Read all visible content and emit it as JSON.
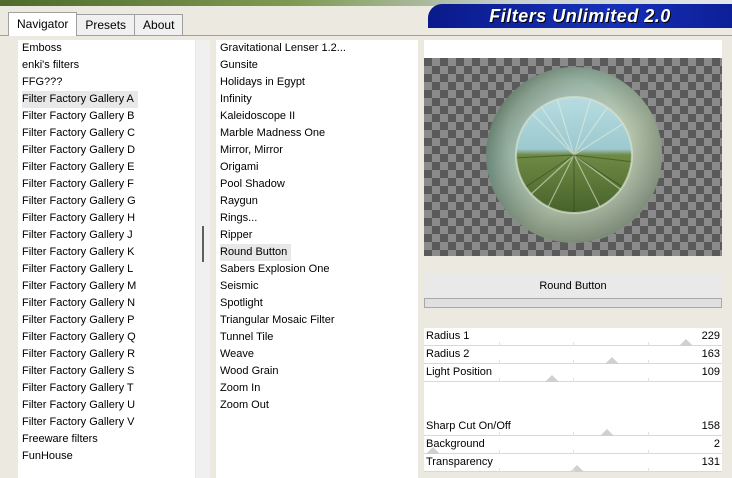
{
  "tabs": [
    "Navigator",
    "Presets",
    "About"
  ],
  "app_title": "Filters Unlimited 2.0",
  "categories": [
    "Emboss",
    "enki's filters",
    "FFG???",
    "Filter Factory Gallery A",
    "Filter Factory Gallery B",
    "Filter Factory Gallery C",
    "Filter Factory Gallery D",
    "Filter Factory Gallery E",
    "Filter Factory Gallery F",
    "Filter Factory Gallery G",
    "Filter Factory Gallery H",
    "Filter Factory Gallery J",
    "Filter Factory Gallery K",
    "Filter Factory Gallery L",
    "Filter Factory Gallery M",
    "Filter Factory Gallery N",
    "Filter Factory Gallery P",
    "Filter Factory Gallery Q",
    "Filter Factory Gallery R",
    "Filter Factory Gallery S",
    "Filter Factory Gallery T",
    "Filter Factory Gallery U",
    "Filter Factory Gallery V",
    "Freeware filters",
    "FunHouse"
  ],
  "selected_category": "Filter Factory Gallery A",
  "filters": [
    "Gravitational Lenser 1.2...",
    "Gunsite",
    "Holidays in Egypt",
    "Infinity",
    "Kaleidoscope II",
    "Marble Madness One",
    "Mirror, Mirror",
    "Origami",
    "Pool Shadow",
    "Raygun",
    "Rings...",
    "Ripper",
    "Round Button",
    "Sabers Explosion One",
    "Seismic",
    "Spotlight",
    "Triangular Mosaic Filter",
    "Tunnel Tile",
    "Weave",
    "Wood Grain",
    "Zoom In",
    "Zoom Out"
  ],
  "selected_filter": "Round Button",
  "current_filter_name": "Round Button",
  "params": [
    {
      "label": "Radius 1",
      "value": "229",
      "level": 0.898
    },
    {
      "label": "Radius 2",
      "value": "163",
      "level": 0.639
    },
    {
      "label": "Light Position",
      "value": "109",
      "level": 0.427
    },
    {
      "label": "Sharp Cut On/Off",
      "value": "158",
      "level": 0.62
    },
    {
      "label": "Background",
      "value": "2",
      "level": 0.008
    },
    {
      "label": "Transparency",
      "value": "131",
      "level": 0.514
    }
  ],
  "colors": {
    "title_bar": "#1630b8",
    "selection": "#e8e8e8",
    "preview_light": "#8a8a8a",
    "preview_dark": "#5a5a5a"
  },
  "icons": [
    "checkerboard-preview",
    "round-button-preview-image"
  ]
}
